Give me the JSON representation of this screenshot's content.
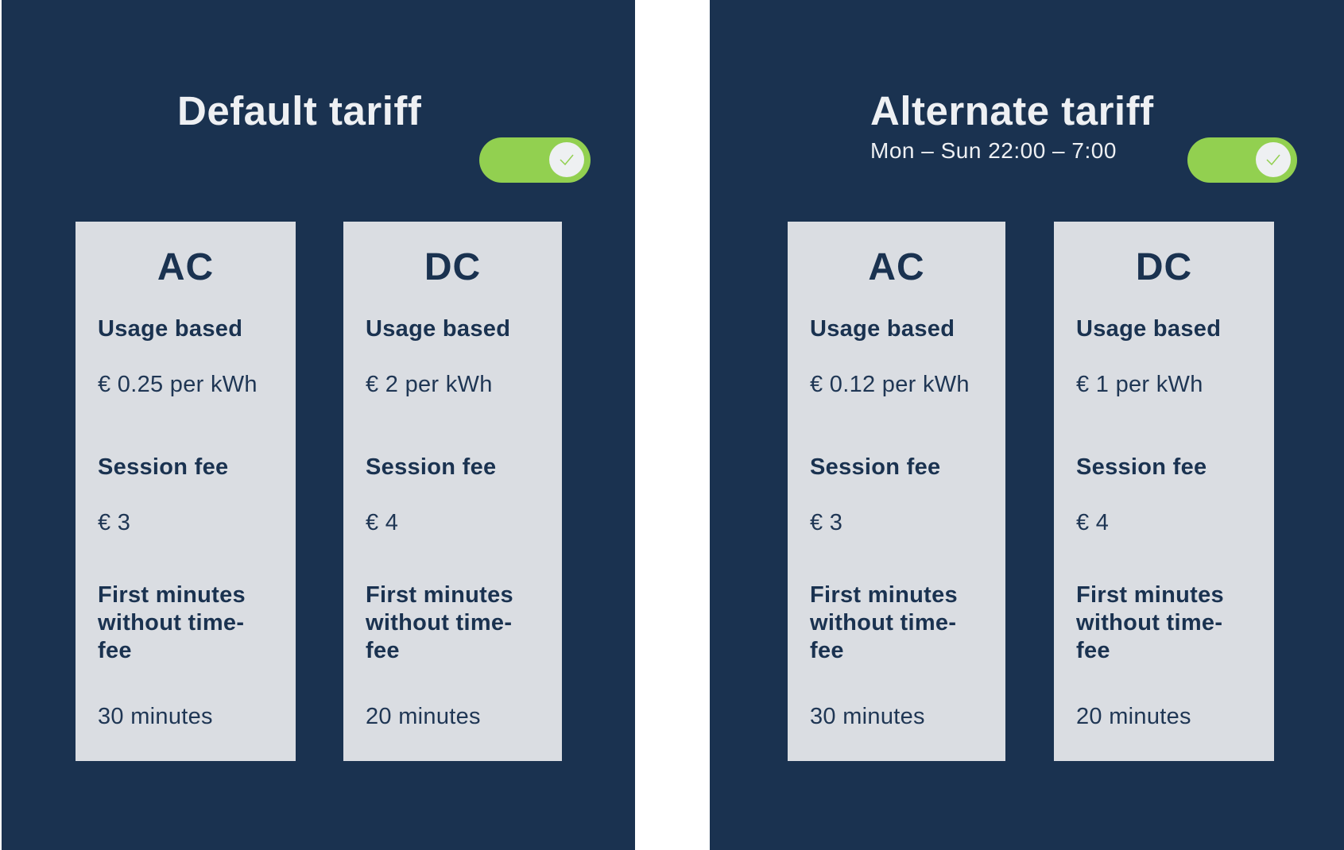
{
  "colors": {
    "panel_bg": "#1a3250",
    "card_bg": "#dadde2",
    "text_dark": "#1a3250",
    "text_light": "#eef0f3",
    "toggle_on": "#92d050"
  },
  "panels": [
    {
      "title": "Default tariff",
      "subtitle": null,
      "toggle": {
        "state": "on",
        "icon": "check-icon"
      },
      "cards": [
        {
          "type": "AC",
          "usage_label": "Usage based",
          "usage_value": "€ 0.25 per kWh",
          "session_label": "Session fee",
          "session_value": "€ 3",
          "free_minutes_label": "First minutes without time-fee",
          "free_minutes_value": "30 minutes"
        },
        {
          "type": "DC",
          "usage_label": "Usage based",
          "usage_value": "€ 2 per kWh",
          "session_label": "Session fee",
          "session_value": "€ 4",
          "free_minutes_label": "First minutes without time-fee",
          "free_minutes_value": "20 minutes"
        }
      ]
    },
    {
      "title": "Alternate tariff",
      "subtitle": "Mon – Sun 22:00 – 7:00",
      "toggle": {
        "state": "on",
        "icon": "check-icon"
      },
      "cards": [
        {
          "type": "AC",
          "usage_label": "Usage based",
          "usage_value": "€ 0.12 per kWh",
          "session_label": "Session fee",
          "session_value": "€ 3",
          "free_minutes_label": "First minutes without time-fee",
          "free_minutes_value": "30 minutes"
        },
        {
          "type": "DC",
          "usage_label": "Usage based",
          "usage_value": "€ 1 per kWh",
          "session_label": "Session fee",
          "session_value": "€ 4",
          "free_minutes_label": "First minutes without time-fee",
          "free_minutes_value": "20 minutes"
        }
      ]
    }
  ]
}
